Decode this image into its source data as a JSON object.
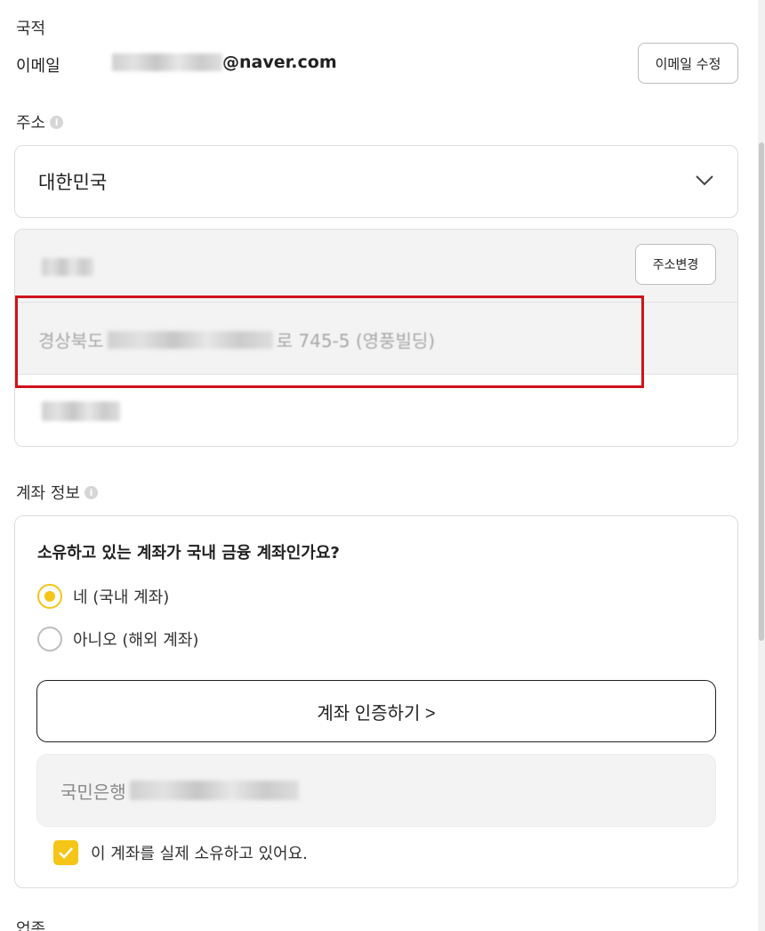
{
  "profile": {
    "nationality_label": "국적",
    "email_label": "이메일",
    "email_domain": "@naver.com",
    "email_edit_label": "이메일 수정"
  },
  "address": {
    "title": "주소",
    "info_glyph": "i",
    "country": "대한민국",
    "change_label": "주소변경",
    "line_prefix": "경상북도",
    "line_suffix": "로 745-5 (영풍빌딩)"
  },
  "account": {
    "title": "계좌 정보",
    "info_glyph": "i",
    "question": "소유하고 있는 계좌가 국내 금융 계좌인가요?",
    "options": [
      {
        "label": "네 (국내 계좌)",
        "selected": true
      },
      {
        "label": "아니오 (해외 계좌)",
        "selected": false
      }
    ],
    "verify_label": "계좌 인증하기 >",
    "bank_name": "국민은행",
    "ownership_label": "이 계좌를 실제 소유하고 있어요.",
    "ownership_checked": true
  },
  "next_section": {
    "title": "업종"
  },
  "colors": {
    "accent": "#f5c518",
    "highlight_border": "#d0121b"
  },
  "icons": {
    "country_dropdown": "chevron-down-icon",
    "info": "info-icon",
    "checkbox": "check-icon"
  }
}
